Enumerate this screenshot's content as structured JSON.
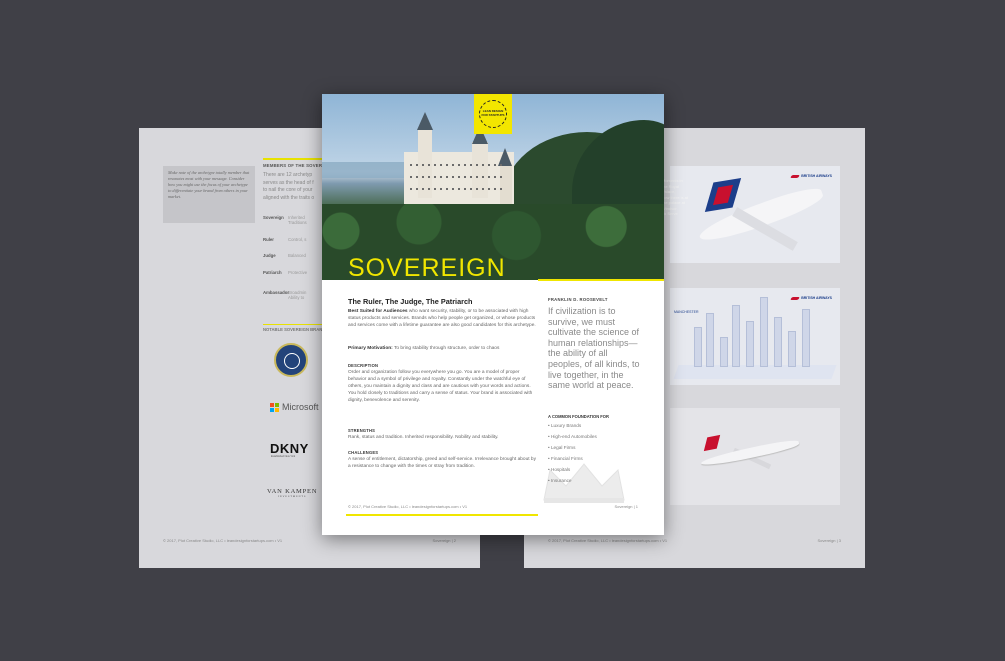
{
  "left_page": {
    "note": "Make note of the archetype totally member that resonates most with your message. Consider how you might use the focus of your archetype to differentiate your brand from others in your market.",
    "section_heading": "MEMBERS OF THE SOVEREIGN",
    "intro_lines": [
      "There are 12 archetyp",
      "serves as the head of f",
      "to nail the core of your",
      "aligned with the traits o"
    ],
    "members": [
      {
        "name": "Sovereign",
        "desc": "Inherited",
        "desc2": "Traditions"
      },
      {
        "name": "Ruler",
        "desc": "Control, s"
      },
      {
        "name": "Judge",
        "desc": "Balanced"
      },
      {
        "name": "Patriarch",
        "desc": "Protective"
      },
      {
        "name": "Ambassador",
        "desc": "Broadmin",
        "desc2": "Ability to"
      }
    ],
    "brands_heading": "NOTABLE SOVEREIGN BRANDS",
    "brands": [
      "Microsoft",
      "DKNY",
      "Established New York",
      "VAN KAMPEN",
      "INVESTMENTS"
    ],
    "footer": "© 2017, Plot Creative Studio, LLC  •  leandesignforstartups.com  •  V1",
    "page_label": "Sovereign  |  2"
  },
  "right_page": {
    "ad_text": [
      "Moments in",
      "the Royal",
      "Palace,",
      "now there is at",
      "the palace at",
      "Windsor.",
      "To Serve"
    ],
    "brand_name": "BRITISH AIRWAYS",
    "ad_city_label": "MANCHESTER",
    "footer": "© 2017, Plot Creative Studio, LLC  •  leandesignforstartups.com  •  V1",
    "page_label": "Sovereign  |  3"
  },
  "front_page": {
    "badge_text": "LEAN DESIGN FOR STARTUPS",
    "title": "SOVEREIGN",
    "subtitle": "The Ruler, The Judge, The Patriarch",
    "best_suited_label": "Best Suited for Audiences",
    "best_suited_text": " who want security, stability, or to be associated with high status products and services. Brands who help people get organized, or whose products and services come with a lifetime guarantee are also good candidates for this archetype.",
    "motivation_label": "Primary Motivation:",
    "motivation_text": " To bring stability through structure, order to chaos",
    "description_heading": "DESCRIPTION",
    "description_text": "Order and organization follow you everywhere you go. You are a model of proper behavior and a symbol of privilege and royalty. Constantly under the watchful eye of others, you maintain a dignity and class and are cautious with your words and actions. You hold closely to traditions and carry a sense of status. Your brand is associated with dignity, benevolence and serenity.",
    "strengths_heading": "STRENGTHS",
    "strengths_text": "Rank, status and tradition. Inherited responsibility. Nobility and stability.",
    "challenges_heading": "CHALLENGES",
    "challenges_text": "A sense of entitlement, dictatorship, greed and self-service. Irrelevance brought about by a resistance to change with the times or stray from tradition.",
    "quote_author": "FRANKLIN D. ROOSEVELT",
    "quote": "If civilization is to survive, we must cultivate the science of human relationships—the ability of all peoples, of all kinds, to live together, in the same world at peace.",
    "foundation_heading": "A COMMON FOUNDATION FOR",
    "foundation_items": [
      "• Luxury Brands",
      "• High-end Automobiles",
      "• Legal Firms",
      "• Financial Firms",
      "• Hospitals",
      "• Insurance"
    ],
    "footer": "© 2017, Plot Creative Studio, LLC  •  leandesignforstartups.com  •  V1",
    "page_label": "Sovereign  |  1"
  },
  "colors": {
    "background": "#404047",
    "accent_yellow": "#f0e600",
    "back_page": "#d8d8dc",
    "ba_blue": "#1c3e8a",
    "ba_red": "#c8102e"
  },
  "icons": [
    "treasury-seal-logo",
    "microsoft-logo",
    "crown-icon",
    "british-airways-logo",
    "plane-image",
    "castle-photo"
  ]
}
